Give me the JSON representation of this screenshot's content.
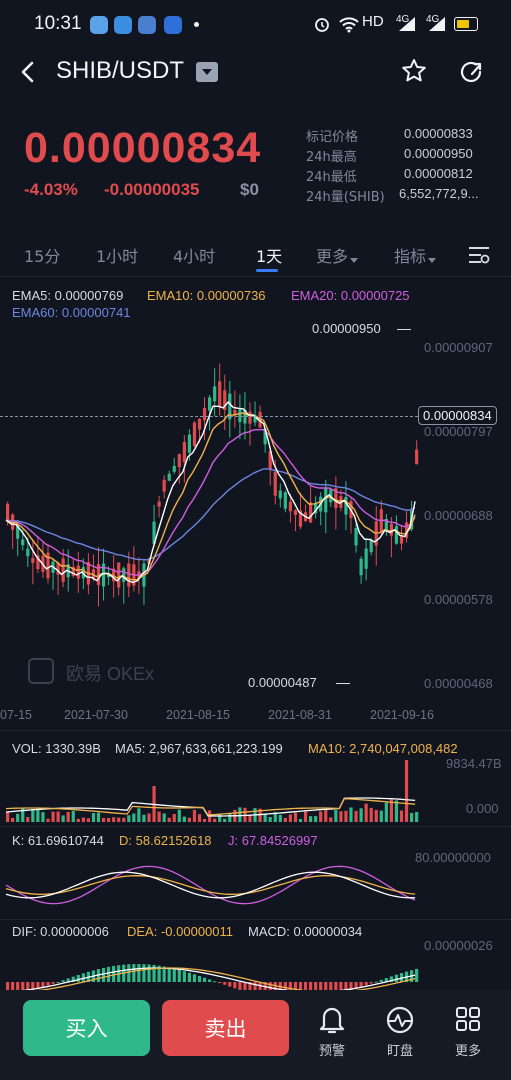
{
  "status_bar": {
    "time": "10:31",
    "hd_label": "HD",
    "net1": "4G",
    "net2": "4G"
  },
  "header": {
    "pair": "SHIB/USDT"
  },
  "ticker": {
    "last_price": "0.00000834",
    "change_pct": "-4.03%",
    "change_abs": "-0.00000035",
    "fiat_value": "$0",
    "stats": [
      {
        "label": "标记价格",
        "value": "0.00000833"
      },
      {
        "label": "24h最高",
        "value": "0.00000950"
      },
      {
        "label": "24h最低",
        "value": "0.00000812"
      },
      {
        "label": "24h量(SHIB)",
        "value": "6,552,772,9..."
      }
    ]
  },
  "timeframes": {
    "items": [
      "15分",
      "1小时",
      "4小时",
      "1天",
      "更多",
      "指标"
    ],
    "active": "1天"
  },
  "main_chart": {
    "ema5": "EMA5: 0.00000769",
    "ema10": "EMA10: 0.00000736",
    "ema20": "EMA20: 0.00000725",
    "ema60": "EMA60: 0.00000741",
    "y_ticks": [
      "0.00000907",
      "0.00000797",
      "0.00000688",
      "0.00000578",
      "0.00000468"
    ],
    "high_label": "0.00000950",
    "low_label": "0.00000487",
    "current_label": "0.00000834",
    "dates": [
      "07-15",
      "2021-07-30",
      "2021-08-15",
      "2021-08-31",
      "2021-09-16"
    ],
    "watermark": "欧易 OKEx"
  },
  "volume": {
    "vol": "VOL: 1330.39B",
    "ma5": "MA5: 2,967,633,661,223.199",
    "ma10": "MA10: 2,740,047,008,482",
    "y_top": "9834.47B",
    "y_bottom": "0.000"
  },
  "kdj": {
    "k": "K: 61.69610744",
    "d": "D: 58.62152618",
    "j": "J: 67.84526997",
    "y_top": "80.00000000"
  },
  "macd": {
    "dif": "DIF: 0.00000006",
    "dea": "DEA: -0.00000011",
    "macd": "MACD: 0.00000034",
    "y_top": "0.00000026"
  },
  "actions": {
    "buy": "买入",
    "sell": "卖出",
    "alert": "预警",
    "watch": "盯盘",
    "more": "更多"
  },
  "colors": {
    "up": "#2fb88a",
    "down": "#e04b4e",
    "ema5": "#ffffff",
    "ema10": "#f0b34a",
    "ema20": "#d05ee0",
    "ema60": "#6e86e0",
    "accent": "#3a7cf5"
  }
}
